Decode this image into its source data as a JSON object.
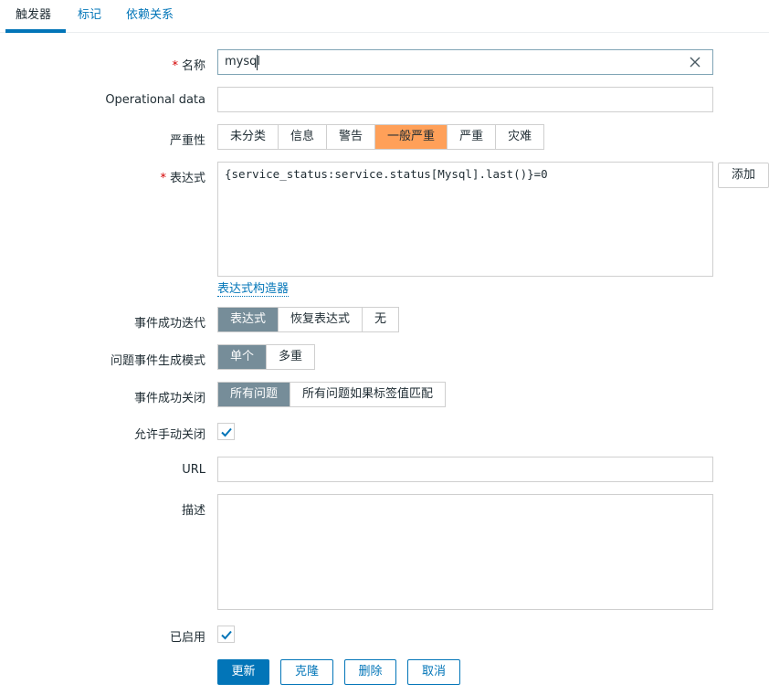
{
  "tabs": [
    {
      "label": "触发器",
      "active": true
    },
    {
      "label": "标记",
      "active": false
    },
    {
      "label": "依赖关系",
      "active": false
    }
  ],
  "form": {
    "name": {
      "label": "名称",
      "value": "mysql",
      "required": true
    },
    "operational_data": {
      "label": "Operational data",
      "value": ""
    },
    "severity": {
      "label": "严重性",
      "options": [
        "未分类",
        "信息",
        "警告",
        "一般严重",
        "严重",
        "灾难"
      ],
      "selected": "一般严重"
    },
    "expression": {
      "label": "表达式",
      "value": "{service_status:service.status[Mysql].last()}=0",
      "required": true,
      "add_button": "添加",
      "builder_link": "表达式构造器"
    },
    "ok_event_generation": {
      "label": "事件成功迭代",
      "options": [
        "表达式",
        "恢复表达式",
        "无"
      ],
      "selected": "表达式"
    },
    "problem_event_mode": {
      "label": "问题事件生成模式",
      "options": [
        "单个",
        "多重"
      ],
      "selected": "单个"
    },
    "ok_event_closes": {
      "label": "事件成功关闭",
      "options": [
        "所有问题",
        "所有问题如果标签值匹配"
      ],
      "selected": "所有问题"
    },
    "allow_manual_close": {
      "label": "允许手动关闭",
      "checked": true
    },
    "url": {
      "label": "URL",
      "value": ""
    },
    "description": {
      "label": "描述",
      "value": ""
    },
    "enabled": {
      "label": "已启用",
      "checked": true
    }
  },
  "buttons": {
    "update": "更新",
    "clone": "克隆",
    "delete": "删除",
    "cancel": "取消"
  },
  "colors": {
    "accent": "#0275b8",
    "severity_selected": "#ffa059",
    "segment_selected": "#768d99"
  }
}
